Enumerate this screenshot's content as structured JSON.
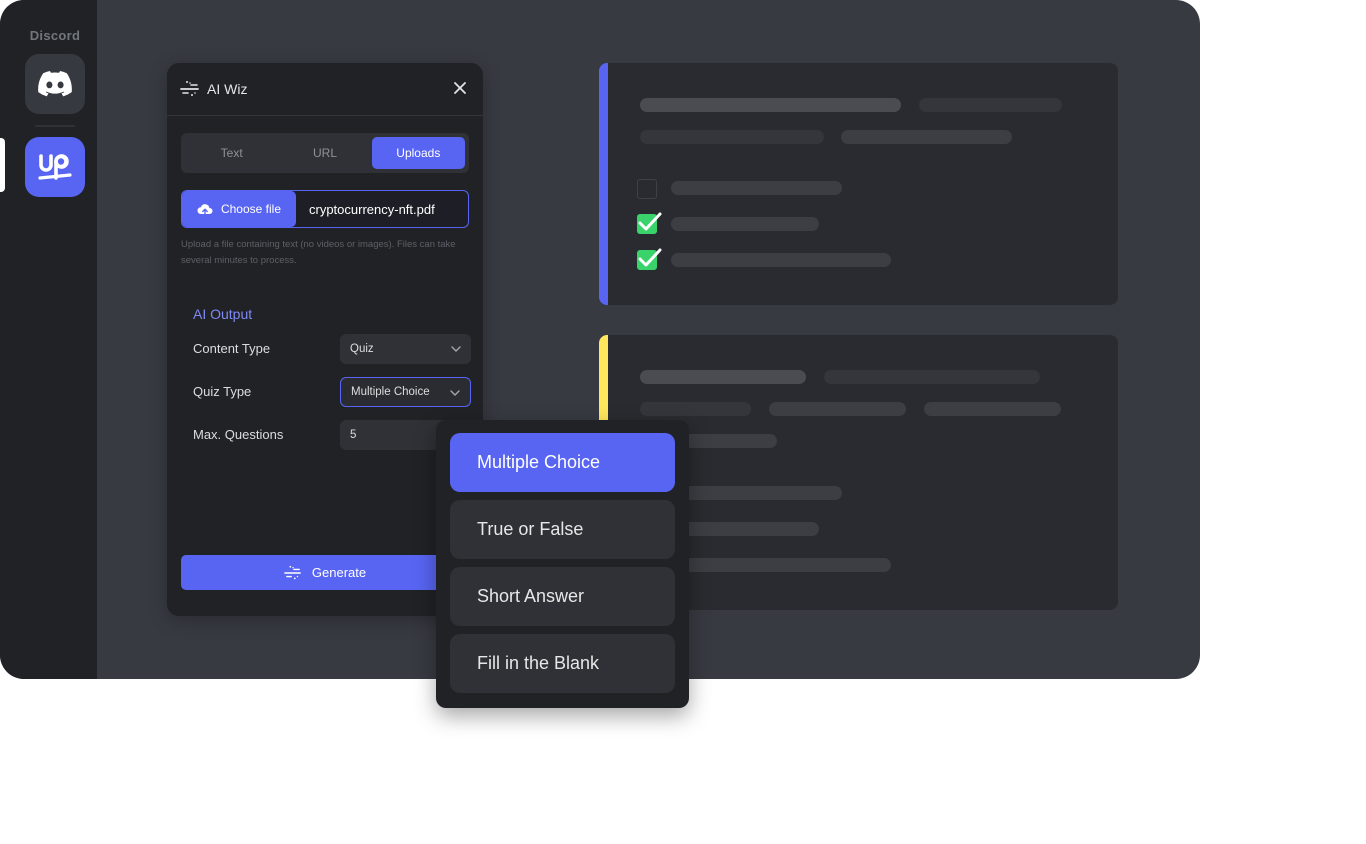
{
  "rail": {
    "title": "Discord",
    "servers": [
      {
        "name": "Discord",
        "icon": "discord-logo-icon"
      },
      {
        "name": "up",
        "icon": "up-logo-icon",
        "selected": true,
        "label": "up"
      }
    ]
  },
  "panel": {
    "title": "AI Wiz",
    "close_icon": "close-icon",
    "tabs": [
      {
        "label": "Text",
        "active": false
      },
      {
        "label": "URL",
        "active": false
      },
      {
        "label": "Uploads",
        "active": true
      }
    ],
    "file": {
      "button_label": "Choose file",
      "file_name": "cryptocurrency-nft.pdf",
      "help_text": "Upload a file containing text (no videos or images). Files can take several minutes to process."
    },
    "output": {
      "section_title": "AI Output",
      "fields": [
        {
          "label": "Content Type",
          "value": "Quiz",
          "type": "select"
        },
        {
          "label": "Quiz Type",
          "value": "Multiple Choice",
          "type": "select",
          "focused": true
        },
        {
          "label": "Max. Questions",
          "value": "5",
          "type": "number"
        }
      ]
    },
    "generate_label": "Generate"
  },
  "dropdown": {
    "options": [
      {
        "label": "Multiple Choice",
        "selected": true
      },
      {
        "label": "True or False",
        "selected": false
      },
      {
        "label": "Short Answer",
        "selected": false
      },
      {
        "label": "Fill in the Blank",
        "selected": false
      }
    ]
  },
  "cards": [
    {
      "accent": "#5865f2",
      "checkboxes": [
        false,
        true,
        true
      ]
    },
    {
      "accent": "#fee75c"
    }
  ],
  "colors": {
    "brand": "#5865f2",
    "success": "#3ad36b",
    "warning": "#fee75c"
  }
}
